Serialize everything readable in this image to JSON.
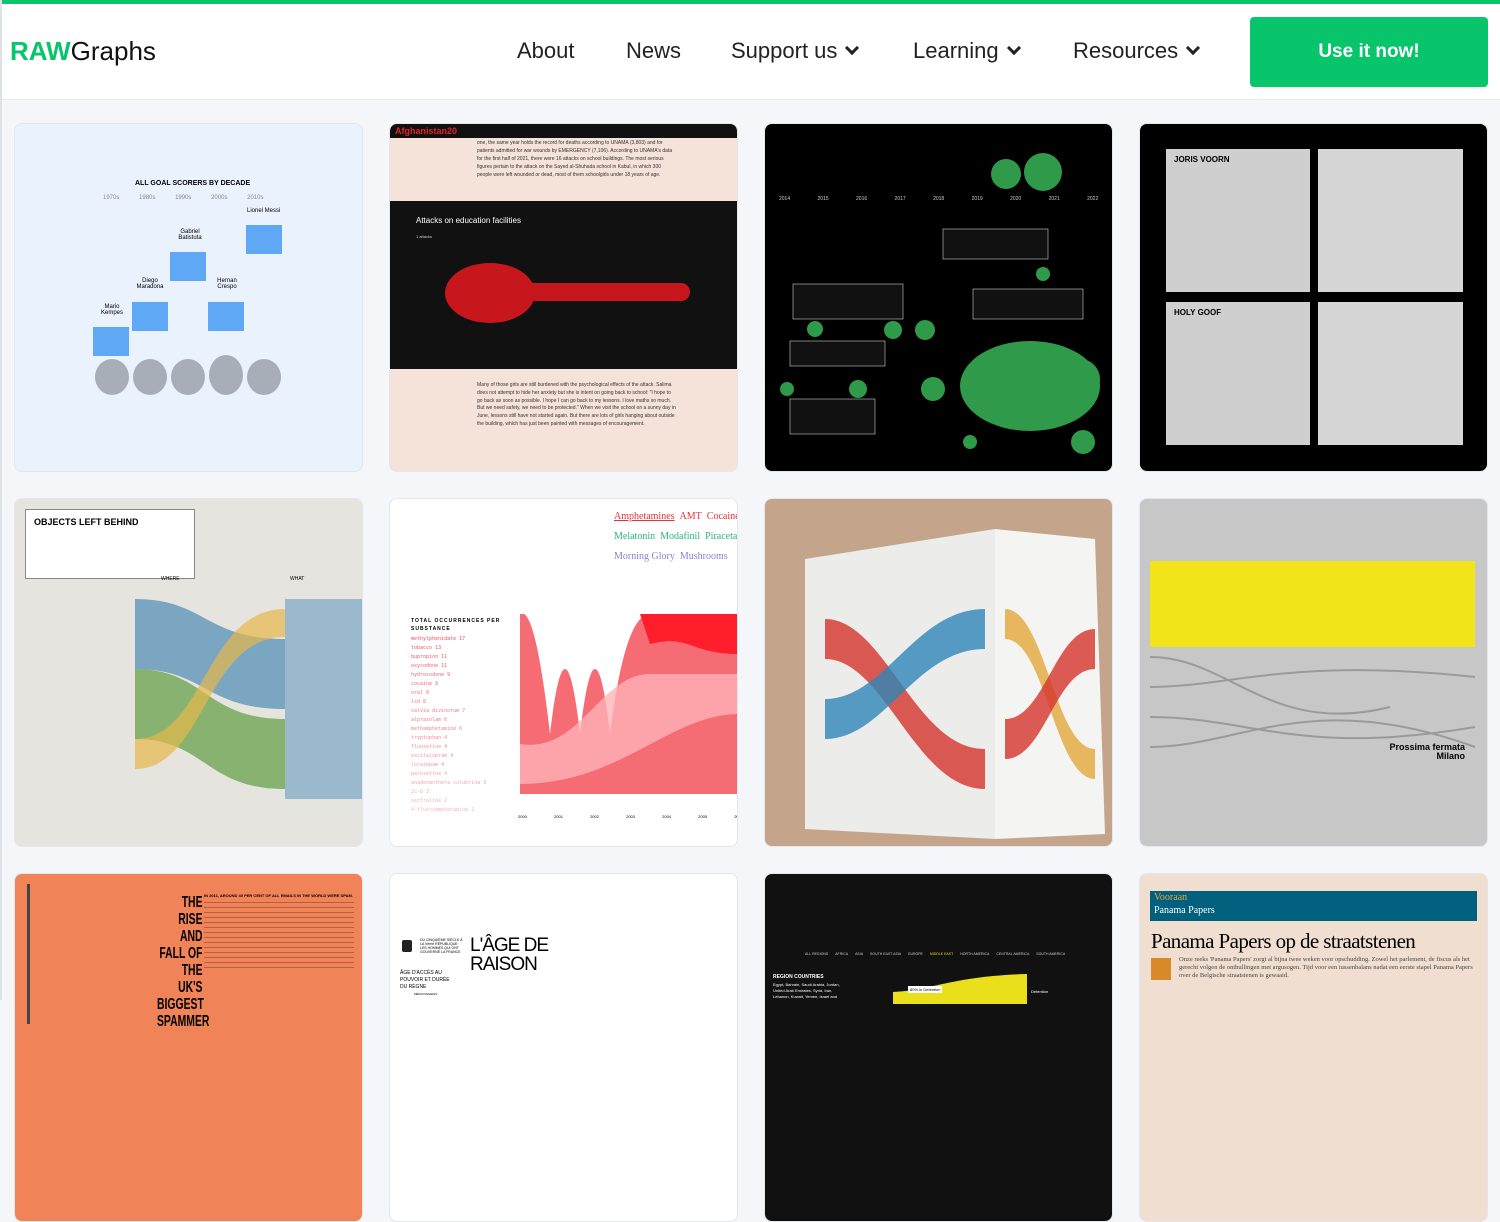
{
  "header": {
    "logo_accent": "RAW",
    "logo_rest": "Graphs",
    "nav": [
      {
        "label": "About"
      },
      {
        "label": "News"
      },
      {
        "label": "Support us",
        "dropdown": true
      },
      {
        "label": "Learning",
        "dropdown": true
      },
      {
        "label": "Resources",
        "dropdown": true
      }
    ],
    "cta": "Use it now!"
  },
  "colors": {
    "brand": "#08c46a"
  },
  "gallery": {
    "goal_scorers": {
      "title": "ALL GOAL SCORERS BY DECADE",
      "decades": [
        "1970s",
        "1980s",
        "1990s",
        "2000s",
        "2010s"
      ],
      "yticks": [
        "60",
        "50",
        "40",
        "30",
        "20",
        "10"
      ],
      "players": [
        "Mario Kempes",
        "Diego Maradona",
        "Gabriel Batistuta",
        "Hernan Crespo",
        "Lionel Messi"
      ]
    },
    "afghanistan": {
      "brand": "Afghanistan20",
      "intro": "one, the same year holds the record for deaths according to UNAMA (3,803) and for patients admitted for war wounds by EMERGENCY (7,106). According to UNAMA's data for the first half of 2021, there were 16 attacks on school buildings. The most serious figures pertain to the attack on the Sayed al-Shuhada school in Kabul, in which 300 people were left wounded or dead, most of them schoolgirls under 18 years of age.",
      "chart_title": "Attacks on education facilities",
      "legend": "1 attacks",
      "body": "Many of those girls are still burdened with the psychological effects of the attack. Salima does not attempt to hide her anxiety but she is intent on going back to school: \"I hope to go back as soon as possible. I hope I can go back to my lessons. I love maths so much. But we need safety, we need to be protected.\" When we visit the school on a sunny day in June, lessons still have not started again. But there are lots of girls hanging about outside the building, which has just been painted with messages of encouragement."
    },
    "satellites": {
      "years": [
        "2014",
        "2015",
        "2016",
        "2017",
        "2018",
        "2019",
        "2020",
        "2021",
        "2022"
      ]
    },
    "joris": {
      "labels": [
        "JORIS VOORN",
        "HOLY GOOF"
      ]
    },
    "objects": {
      "title": "OBJECTS LEFT BEHIND",
      "where": "WHERE",
      "what": "WHAT"
    },
    "substances": {
      "tags_red": [
        "Amphetamines",
        "AMT",
        "Cocaine"
      ],
      "tags_green": [
        "Melatonin",
        "Modafinil",
        "Piracetam"
      ],
      "tags_purple": [
        "Morning Glory",
        "Mushrooms"
      ],
      "heading": "TOTAL OCCURRENCES PER SUBSTANCE",
      "list": [
        "methylphenidate 17",
        "tobacco 13",
        "bupropion 11",
        "oxycodone 11",
        "hydrocodone 9",
        "cocaine 8",
        "oral 8",
        "lsd 8",
        "salvia divinorum 7",
        "alprazolam 6",
        "methamphetamine 6",
        "tryptophan 4",
        "fluoxetine 4",
        "escitalopram 4",
        "lorazepam 4",
        "paroxetine 4",
        "anadenanthera colubrina 3",
        "2c-b 3",
        "sertraline 2",
        "4-fluoroamphetamine 2"
      ],
      "years": [
        "2000",
        "2001",
        "2002",
        "2003",
        "2004",
        "2005",
        "2006"
      ]
    },
    "milano": {
      "title": "Prossima fermata Milano"
    },
    "spammer": {
      "title": "THE RISE AND FALL OF THE UK'S BIGGEST SPAMMER",
      "lead": "IN 2011, AROUND 40 PER CENT OF ALL EMAILS IN THE WORLD WERE SPAM."
    },
    "age_raison": {
      "kicker": "DU CINQUIÈME SIÈCLE À LA Vème RÉPUBLIQUE LES HOMMES QUI ONT GOUVERNÉ LA FRANCE",
      "title": "L'ÂGE DE RAISON",
      "sub": "ÂGE D'ACCÈS AU POUVOIR ET DURÉE DU RÈGNE",
      "legend": "MÉROVINGIENS"
    },
    "detention": {
      "regions": [
        "ALL REGIONS",
        "AFRICA",
        "ASIA",
        "SOUTH EAST ASIA",
        "EUROPE",
        "MIDDLE EAST",
        "NORTH AMERICA",
        "CENTRAL AMERICA",
        "SOUTH AMERICA"
      ],
      "region_title": "REGION COUNTRIES",
      "countries": "Egypt, Bahrain, Saudi Arabia, Jordan, United Arab Emirates, Syria, Iran, Lebanon, Kuwait, Yemen, Israel and",
      "label": "Detention",
      "tooltip": "80% in Detention"
    },
    "panama": {
      "kicker": "Vooraan",
      "section": "Panama Papers",
      "headline": "Panama Papers op de straatstenen",
      "lead": "Onze reeks 'Panama Papers' zorgt al bijna twee weken voor opschudding. Zowel het parlement, de fiscus als het gerecht volgen de onthullingen met argusogen. Tijd voor een tussenbalans nadat een eerste stapel Panama Papers over de Belgische straatstenen is gewaaid."
    }
  }
}
